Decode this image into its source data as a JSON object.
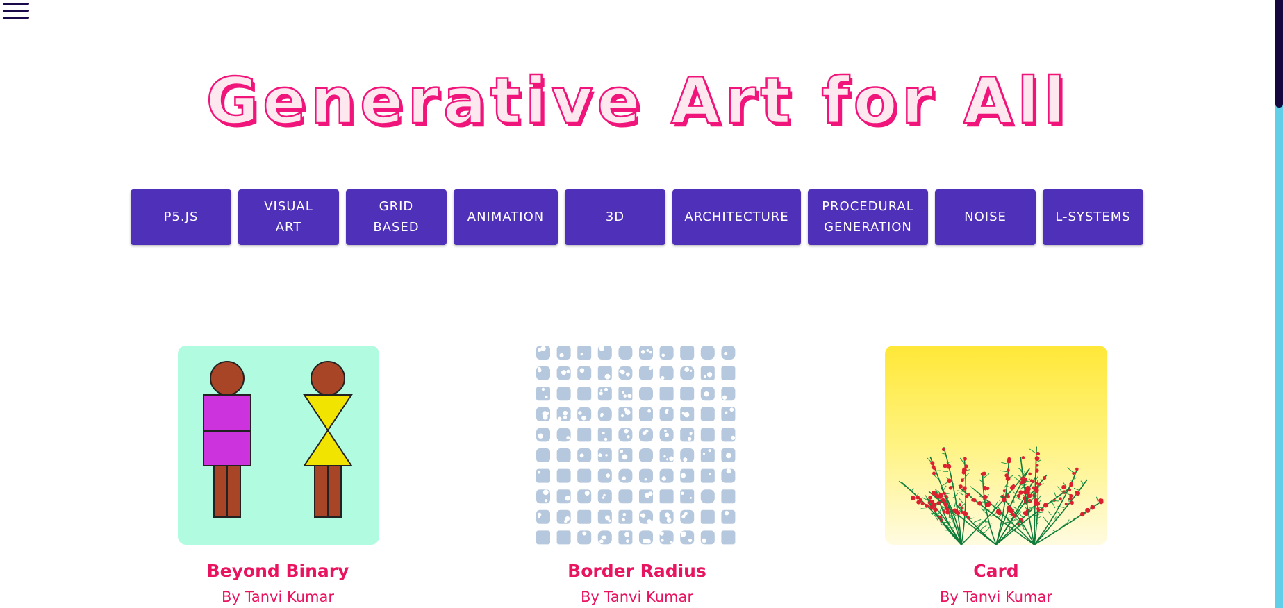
{
  "nav": {
    "menu_icon": "hamburger-menu-icon"
  },
  "hero": {
    "title": "Generative Art for All"
  },
  "tags": [
    {
      "label": "P5.JS"
    },
    {
      "label": "VISUAL\nART"
    },
    {
      "label": "GRID\nBASED"
    },
    {
      "label": "ANIMATION"
    },
    {
      "label": "3D"
    },
    {
      "label": "ARCHITECTURE"
    },
    {
      "label": "PROCEDURAL\nGENERATION"
    },
    {
      "label": "NOISE"
    },
    {
      "label": "L-SYSTEMS"
    }
  ],
  "cards": [
    {
      "title": "Beyond Binary",
      "author": "By Tanvi Kumar"
    },
    {
      "title": "Border Radius",
      "author": "By Tanvi Kumar"
    },
    {
      "title": "Card",
      "author": "By Tanvi Kumar"
    }
  ],
  "colors": {
    "accent_pink": "#f0157a",
    "tag_purple": "#4f30b8",
    "scrollbar_track": "#62cfe9",
    "scrollbar_thumb": "#16073f"
  }
}
